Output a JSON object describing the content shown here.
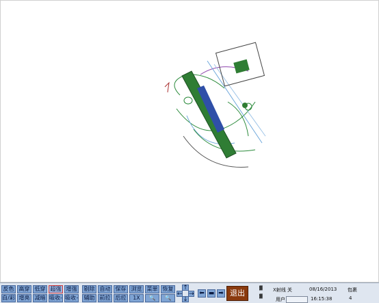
{
  "toolbar": {
    "row1": [
      "反色",
      "高穿",
      "低穿",
      "超强",
      "增强",
      "剔除",
      "自动",
      "保存",
      "浏览",
      "菜单",
      "恢复"
    ],
    "row2": [
      "白/彩",
      "增亮",
      "减暗",
      "吸收-",
      "吸收+",
      "辅助",
      "前拉",
      "后拉",
      "1X",
      "zoom-out-icon",
      "zoom-in-icon"
    ],
    "active": "超强",
    "exit_label": "退出",
    "xray_label": "X射线 关",
    "date": "08/16/2013",
    "bag_label": "包裹",
    "user_label": "用户",
    "time": "16:15:38",
    "bag_count": "4",
    "accent_color": "#8a3a0e",
    "button_color": "#7fa4d4"
  }
}
